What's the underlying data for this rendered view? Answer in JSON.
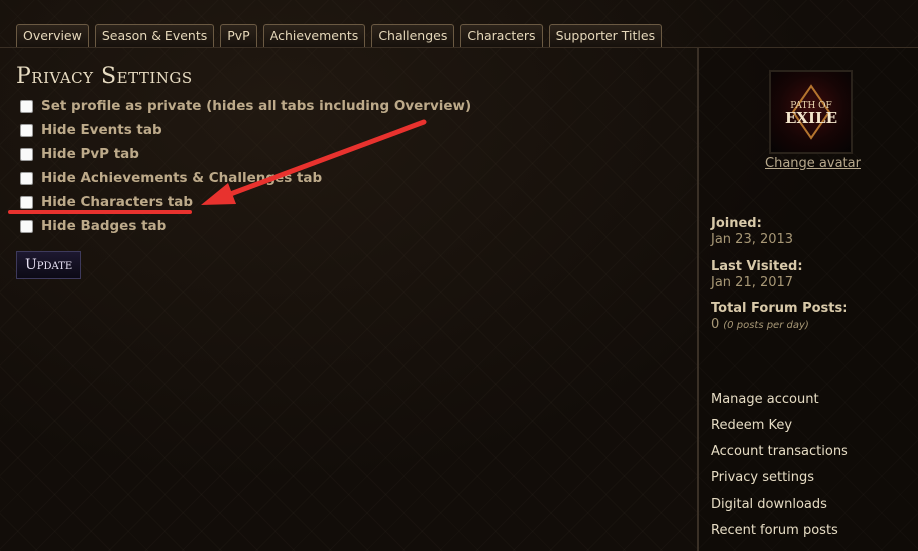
{
  "tabs": [
    {
      "label": "Overview"
    },
    {
      "label": "Season & Events"
    },
    {
      "label": "PvP"
    },
    {
      "label": "Achievements"
    },
    {
      "label": "Challenges"
    },
    {
      "label": "Characters"
    },
    {
      "label": "Supporter Titles"
    }
  ],
  "privacy": {
    "title": "Privacy Settings",
    "options": [
      {
        "label": "Set profile as private (hides all tabs including Overview)",
        "checked": false
      },
      {
        "label": "Hide Events tab",
        "checked": false
      },
      {
        "label": "Hide PvP tab",
        "checked": false
      },
      {
        "label": "Hide Achievements & Challenges tab",
        "checked": false
      },
      {
        "label": "Hide Characters tab",
        "checked": false
      },
      {
        "label": "Hide Badges tab",
        "checked": false
      }
    ],
    "update_label": "Update"
  },
  "annotation": {
    "color": "#e8322e"
  },
  "sidebar": {
    "avatar": {
      "logo_line1": "PATH OF",
      "logo_line2": "EXILE",
      "change_label": "Change avatar"
    },
    "joined_label": "Joined:",
    "joined_value": "Jan 23, 2013",
    "last_visited_label": "Last Visited:",
    "last_visited_value": "Jan 21, 2017",
    "forum_posts_label": "Total Forum Posts:",
    "forum_posts_value": "0",
    "forum_posts_note": "(0 posts per day)",
    "links": [
      {
        "label": "Manage account"
      },
      {
        "label": "Redeem Key"
      },
      {
        "label": "Account transactions"
      },
      {
        "label": "Privacy settings"
      },
      {
        "label": "Digital downloads"
      },
      {
        "label": "Recent forum posts"
      }
    ]
  }
}
